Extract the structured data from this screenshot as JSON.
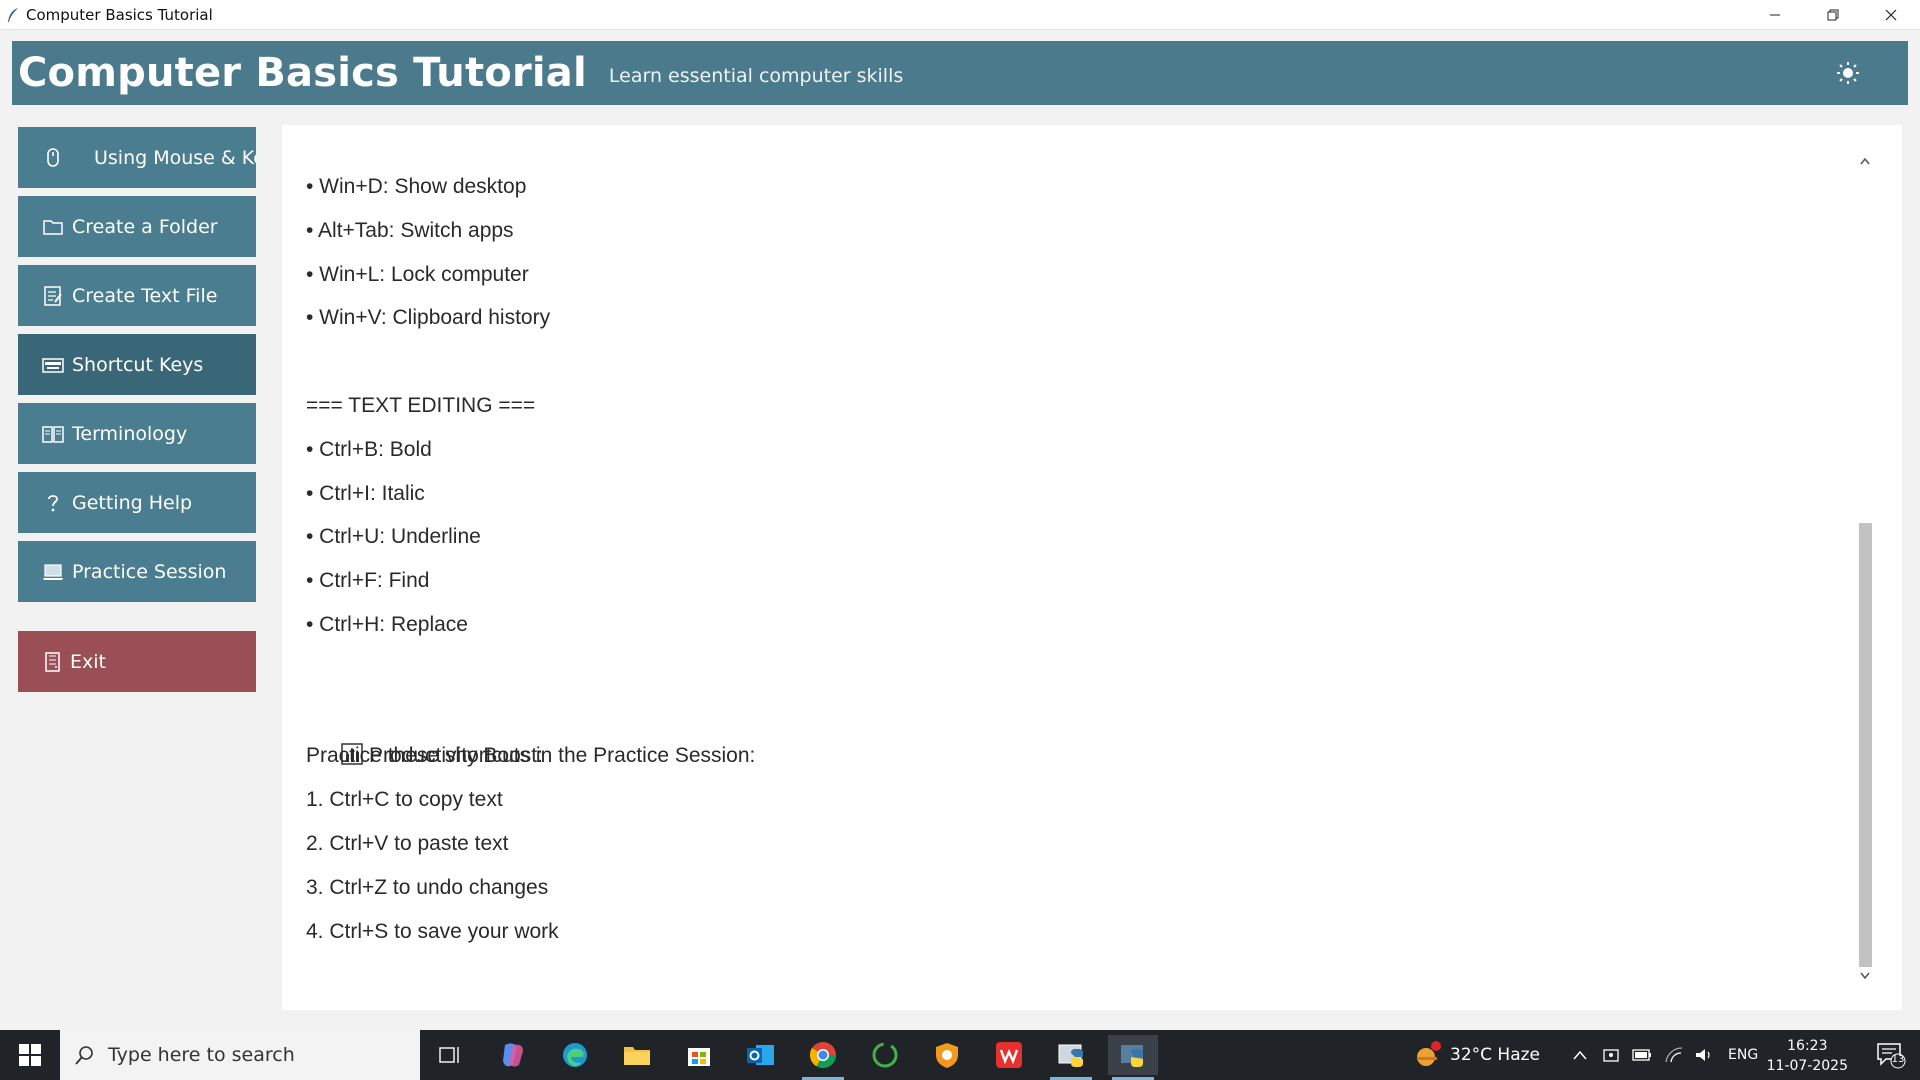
{
  "window": {
    "title": "Computer Basics Tutorial"
  },
  "header": {
    "title": "Computer Basics Tutorial",
    "subtitle": "Learn essential computer skills",
    "theme_icon": "sun-icon"
  },
  "sidebar": {
    "items": [
      {
        "label": "Using Mouse & Keyboard",
        "icon": "mouse-icon"
      },
      {
        "label": "Create a Folder",
        "icon": "folder-icon"
      },
      {
        "label": "Create Text File",
        "icon": "memo-icon"
      },
      {
        "label": "Shortcut Keys",
        "icon": "keyboard-icon"
      },
      {
        "label": "Terminology",
        "icon": "book-icon"
      },
      {
        "label": "Getting Help",
        "icon": "question-icon"
      },
      {
        "label": "Practice Session",
        "icon": "laptop-icon"
      }
    ],
    "active_index": 3,
    "exit": {
      "label": "Exit",
      "icon": "door-icon"
    }
  },
  "content": {
    "lines": [
      "• Win+D: Show desktop",
      "• Alt+Tab: Switch apps",
      "• Win+L: Lock computer",
      "• Win+V: Clipboard history",
      "",
      "=== TEXT EDITING ===",
      "• Ctrl+B: Bold",
      "• Ctrl+I: Italic",
      "• Ctrl+U: Underline",
      "• Ctrl+F: Find",
      "• Ctrl+H: Replace",
      "",
      "Productivity Boost:",
      "Practice these shortcuts in the Practice Session:",
      "1. Ctrl+C to copy text",
      "2. Ctrl+V to paste text",
      "3. Ctrl+Z to undo changes",
      "4. Ctrl+S to save your work"
    ]
  },
  "taskbar": {
    "search_placeholder": "Type here to search",
    "weather": "32°C  Haze",
    "language": "ENG",
    "time": "16:23",
    "date": "11-07-2025",
    "notification_count": "13"
  },
  "colors": {
    "header": "#4a7a8c",
    "nav": "#4a7d8f",
    "nav_active": "#3a6778",
    "exit": "#9a4e55"
  }
}
